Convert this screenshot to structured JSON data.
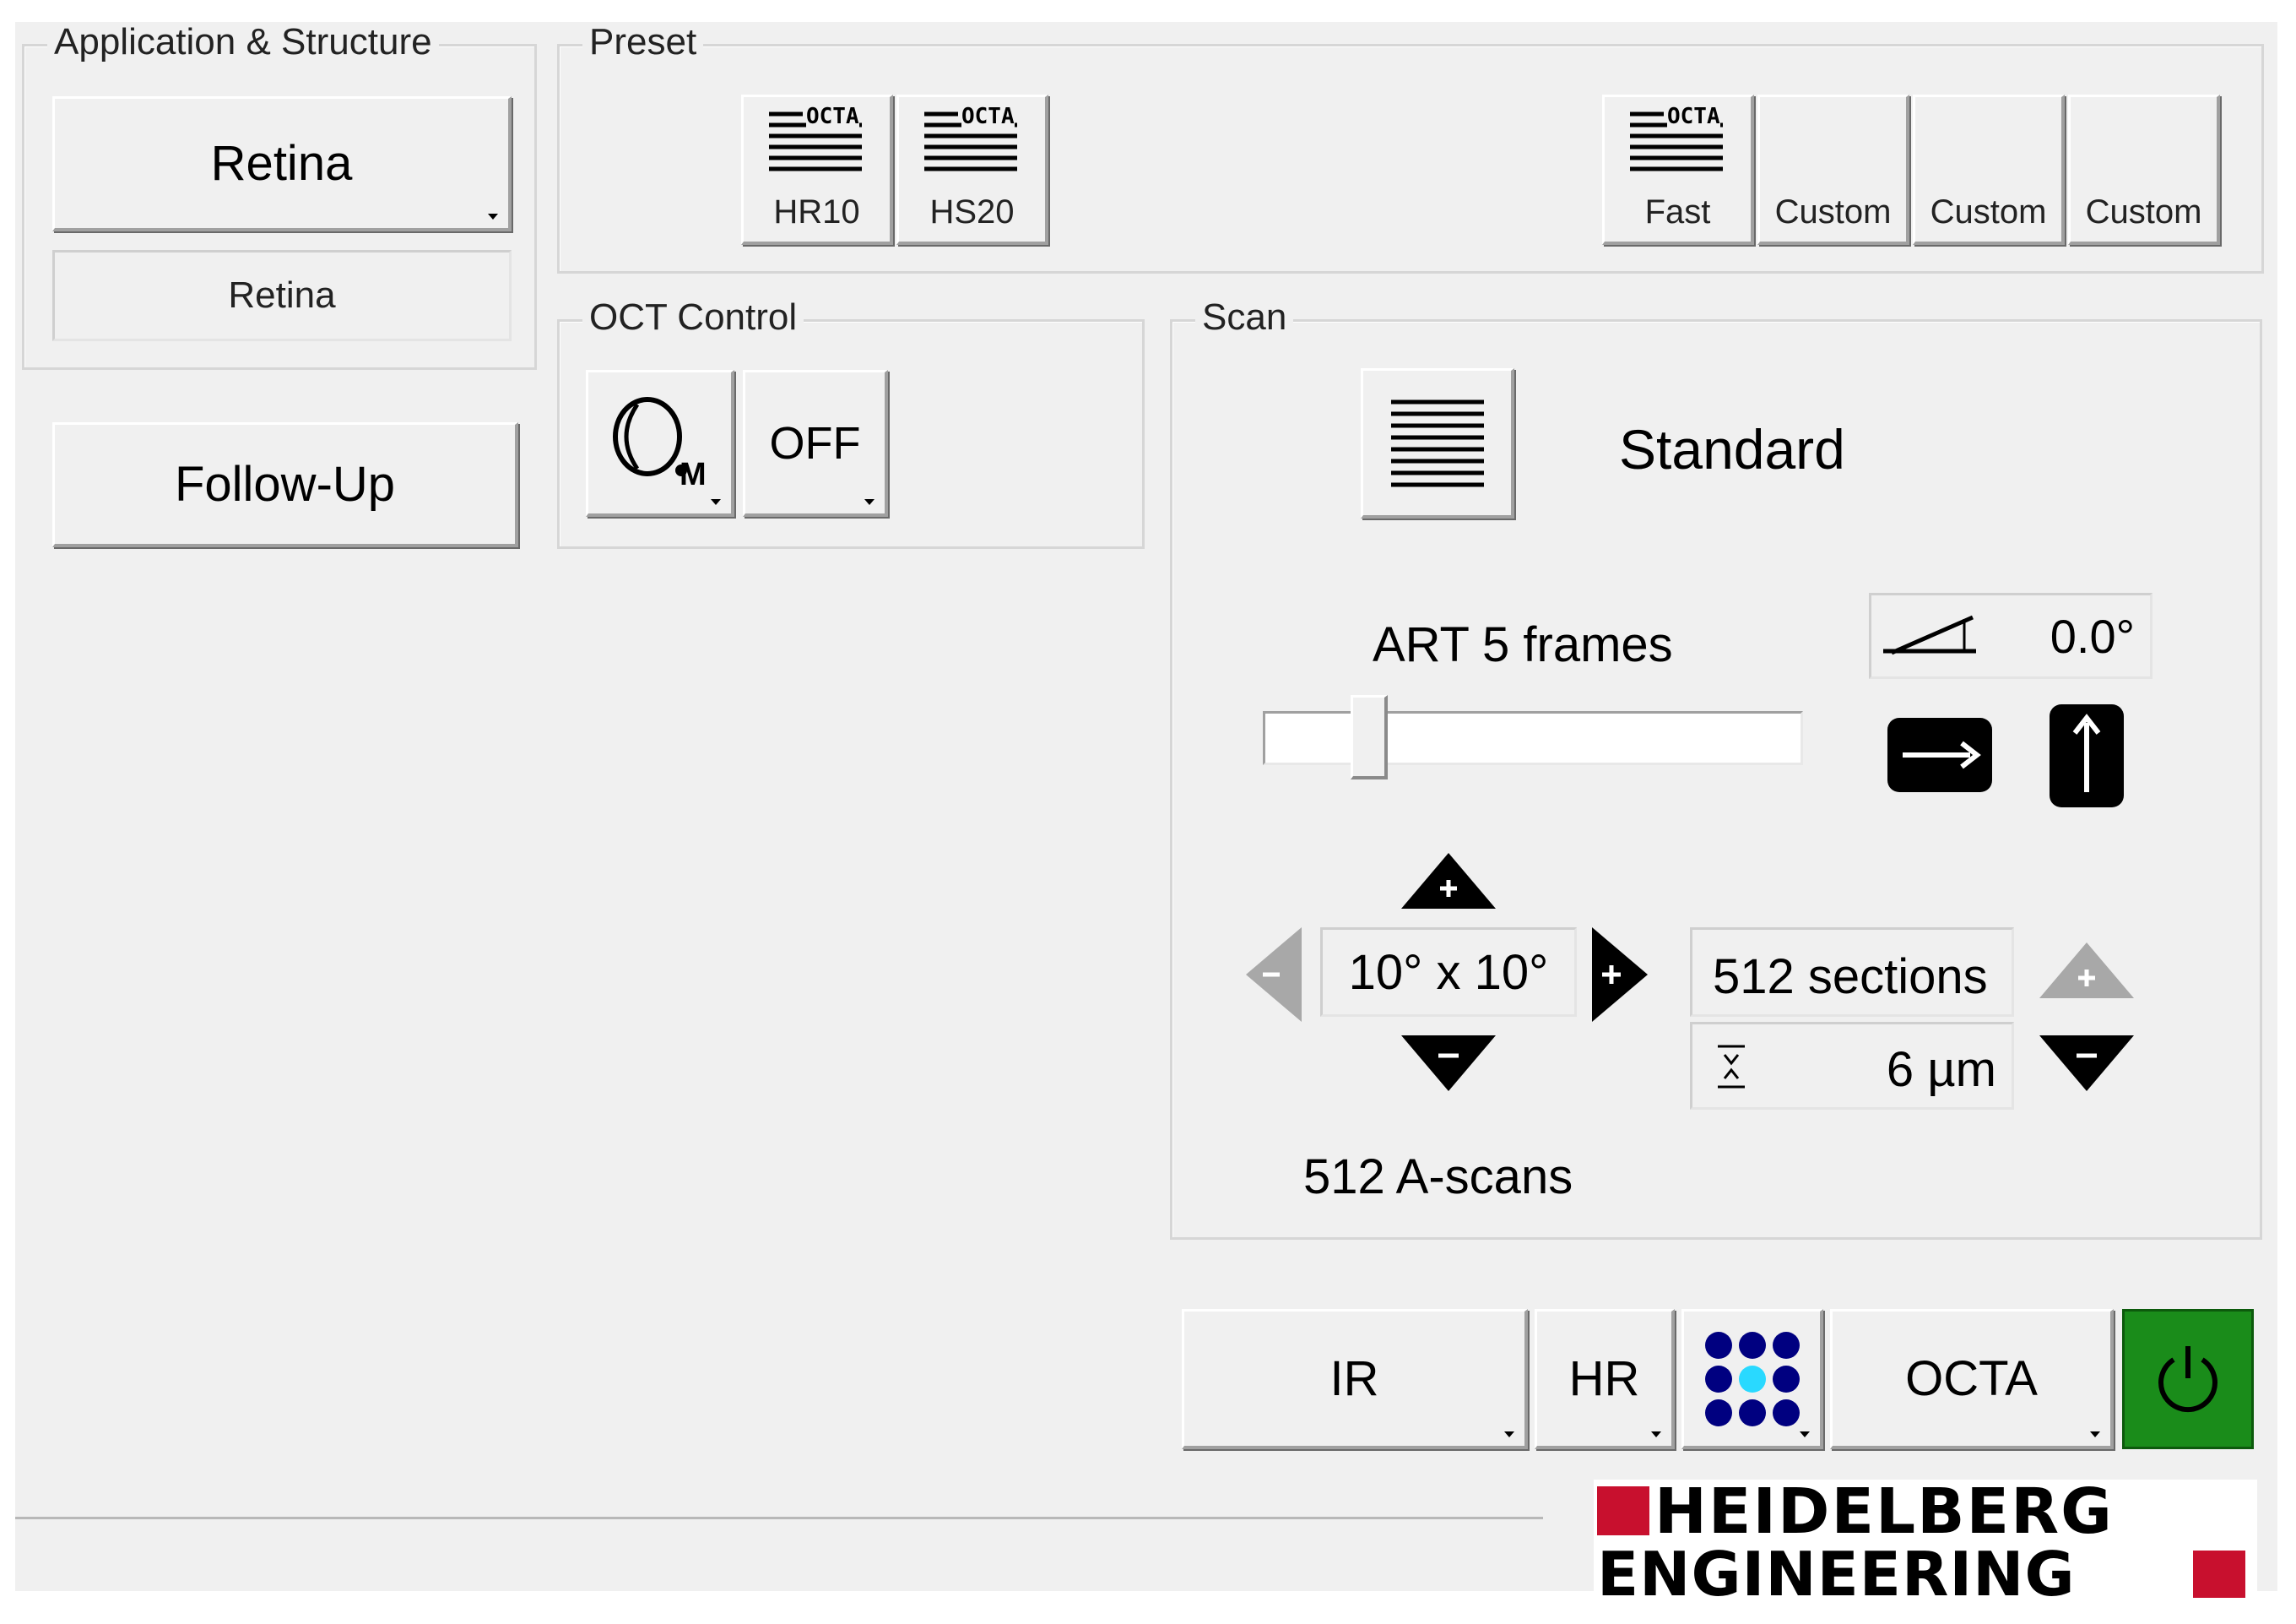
{
  "application_structure": {
    "legend": "Application & Structure",
    "selected": "Retina",
    "sub_value": "Retina"
  },
  "follow_up": {
    "label": "Follow-Up"
  },
  "preset": {
    "legend": "Preset",
    "badge": "OCTA",
    "buttons": [
      {
        "label": "HR10",
        "has_icon": true
      },
      {
        "label": "HS20",
        "has_icon": true
      },
      {
        "label": "Fast",
        "has_icon": true
      },
      {
        "label": "Custom",
        "has_icon": false
      },
      {
        "label": "Custom",
        "has_icon": false
      },
      {
        "label": "Custom",
        "has_icon": false
      }
    ]
  },
  "oct_control": {
    "legend": "OCT Control",
    "eye_badge": "M",
    "state": "OFF"
  },
  "scan": {
    "legend": "Scan",
    "pattern": "Standard",
    "art_label": "ART 5 frames",
    "art_slider_fraction": 0.17,
    "angle": "0.0°",
    "size": "10° x 10°",
    "sections": "512 sections",
    "spacing": "6 µm",
    "a_scans": "512 A-scans"
  },
  "modes": {
    "ir": "IR",
    "hr": "HR",
    "octa": "OCTA",
    "power_color": "#1a8c1a"
  },
  "logo": {
    "line1": "HEIDELBERG",
    "line2": "ENGINEERING",
    "accent": "#c8102e"
  }
}
